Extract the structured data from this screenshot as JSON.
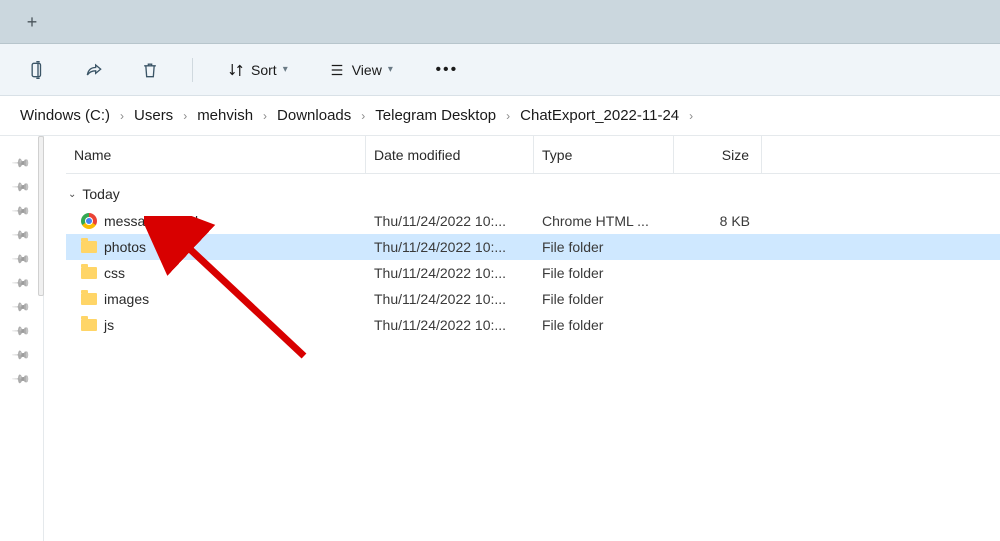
{
  "toolbar": {
    "sort_label": "Sort",
    "view_label": "View"
  },
  "breadcrumb": [
    "Windows (C:)",
    "Users",
    "mehvish",
    "Downloads",
    "Telegram Desktop",
    "ChatExport_2022-11-24"
  ],
  "columns": {
    "name": "Name",
    "date": "Date modified",
    "type": "Type",
    "size": "Size"
  },
  "group_label": "Today",
  "files": [
    {
      "name": "messages.html",
      "date": "Thu/11/24/2022 10:...",
      "type": "Chrome HTML ...",
      "size": "8 KB",
      "icon": "chrome",
      "selected": false
    },
    {
      "name": "photos",
      "date": "Thu/11/24/2022 10:...",
      "type": "File folder",
      "size": "",
      "icon": "folder",
      "selected": true
    },
    {
      "name": "css",
      "date": "Thu/11/24/2022 10:...",
      "type": "File folder",
      "size": "",
      "icon": "folder",
      "selected": false
    },
    {
      "name": "images",
      "date": "Thu/11/24/2022 10:...",
      "type": "File folder",
      "size": "",
      "icon": "folder",
      "selected": false
    },
    {
      "name": "js",
      "date": "Thu/11/24/2022 10:...",
      "type": "File folder",
      "size": "",
      "icon": "folder",
      "selected": false
    }
  ],
  "pins_count": 10
}
